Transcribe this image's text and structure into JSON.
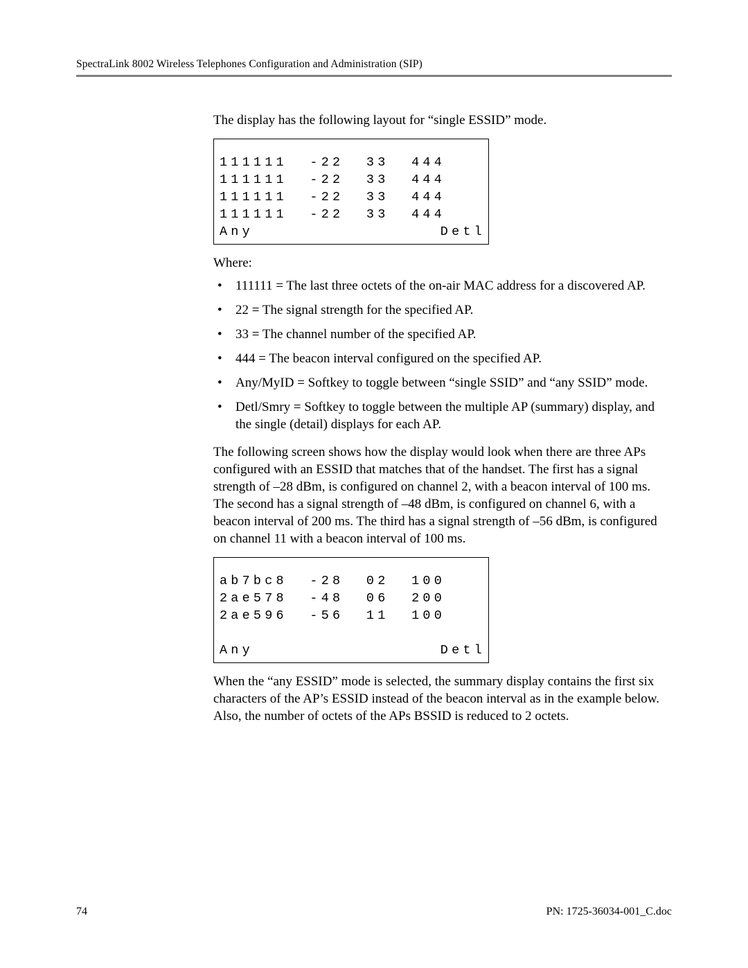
{
  "header": {
    "title": "SpectraLink 8002 Wireless Telephones Configuration and Administration (SIP)"
  },
  "intro": "The display has the following layout for  “single ESSID” mode.",
  "layoutBox": {
    "rows": [
      "111111  -22  33  444",
      "111111  -22  33  444",
      "111111  -22  33  444",
      "111111  -22  33  444"
    ],
    "softkeyLeft": "Any",
    "softkeyRight": "Detl"
  },
  "whereLabel": "Where:",
  "bullets": [
    "111111 = The last three octets of the on-air MAC address for a discovered AP.",
    "22 = The signal strength for the specified AP.",
    "33 = The channel number of the specified AP.",
    "444 = The beacon interval configured on the specified AP.",
    "Any/MyID = Softkey to toggle between “single SSID” and “any SSID” mode.",
    "Detl/Smry = Softkey to toggle between the multiple AP (summary) display, and the single (detail) displays for each AP."
  ],
  "examplePara": "The following screen shows how the display would look when there are three APs configured with an ESSID that matches that of the handset.  The first has a signal strength of –28 dBm, is configured on channel 2, with a beacon interval of 100 ms.  The second has a signal strength of –48 dBm, is configured on channel 6, with a beacon interval of 200 ms.  The third has a signal strength of –56 dBm, is configured on channel 11 with a beacon interval of 100 ms.",
  "exampleBox": {
    "rows": [
      "ab7bc8  -28  02  100",
      "2ae578  -48  06  200",
      "2ae596  -56  11  100"
    ],
    "softkeyLeft": "Any",
    "softkeyRight": "Detl"
  },
  "closingPara": "When the “any ESSID” mode is selected, the summary display contains the first six characters of the AP’s ESSID instead of the beacon interval as in the example below. Also, the number of octets of the APs BSSID is reduced to 2 octets.",
  "footer": {
    "pageNum": "74",
    "docId": "PN: 1725-36034-001_C.doc"
  }
}
